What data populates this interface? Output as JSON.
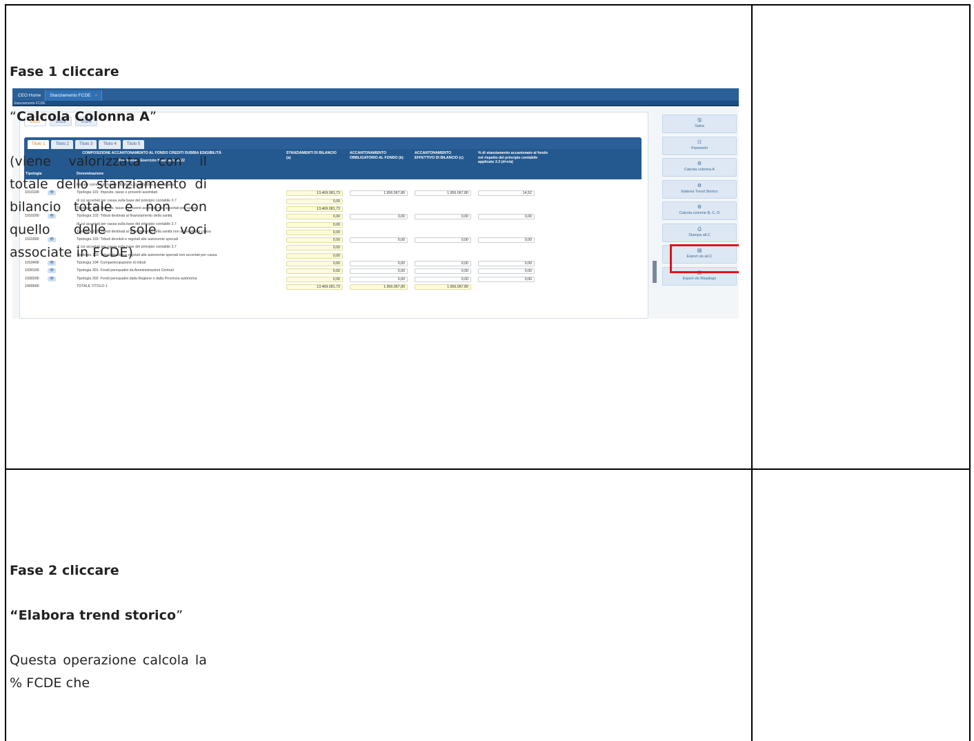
{
  "screenshot": {
    "app_tabs": [
      {
        "label": "CEO Home"
      },
      {
        "label": "Stanziamento FCDE"
      }
    ],
    "close_glyph": "×",
    "subtitle": "Stanziamento FCDE",
    "years": [
      "2022",
      "2023",
      "2024"
    ],
    "title_tabs": [
      "Titolo 1",
      "Titolo 2",
      "Titolo 3",
      "Titolo 4",
      "Titolo 5"
    ],
    "header": {
      "group_title": "COMPOSIZIONE ACCANTONAMENTO AL FONDO CREDITI DUBBIA ESIGIBILITÀ",
      "group_subtitle": "Previsione - Esercizio finanziario 2022",
      "col_tipologia": "Tipologia",
      "col_denominazione": "Denominazione",
      "col_a": "STANZIAMENTI DI BILANCIO (a)",
      "col_b": "ACCANTONAMENTO OBBLIGATORIO AL FONDO (b)",
      "col_c": "ACCANTONAMENTO EFFETTIVO DI BILANCIO (c)",
      "col_d": "% di stanziamento accantonato al fondo nel rispetto del principio contabile applicato 3.3 (d=c/a)"
    },
    "rows": [
      {
        "code": "",
        "eye": false,
        "den": "Entrate correnti di natura tributaria, contributiva e perequativa",
        "a": null,
        "b": null,
        "c": null,
        "d": null
      },
      {
        "code": "1010100",
        "eye": true,
        "den": "Tipologia 101: Imposte, tasse e proventi assimilati",
        "a": "13.469.081,73",
        "b": "1.956.067,80",
        "c": "1.956.067,80",
        "d": "14,52"
      },
      {
        "code": "",
        "eye": false,
        "den": "di cui accertati per cassa sulla base del principio contabile 3.7",
        "a": "0,00",
        "b": null,
        "c": null,
        "d": null
      },
      {
        "code": "",
        "eye": false,
        "den": "Tipologia 101: Imposte, tasse e proventi assimilati non accertati per cassa",
        "a": "13.469.081,73",
        "b": null,
        "c": null,
        "d": null
      },
      {
        "code": "1010200",
        "eye": true,
        "den": "Tipologia 102: Tributi destinati al finanziamento della sanità",
        "a": "0,00",
        "b": "0,00",
        "c": "0,00",
        "d": "0,00"
      },
      {
        "code": "",
        "eye": false,
        "den": "di cui accertati per cassa sulla base del principio contabile 3.7",
        "a": "0,00",
        "b": null,
        "c": null,
        "d": null
      },
      {
        "code": "",
        "eye": false,
        "den": "Tipologia 102: Tributi destinati al finanziamento della sanità non accertati per cassa",
        "a": "0,00",
        "b": null,
        "c": null,
        "d": null
      },
      {
        "code": "1010300",
        "eye": true,
        "den": "Tipologia 103: Tributi devoluti e regolati alle autonomie speciali",
        "a": "0,00",
        "b": "0,00",
        "c": "0,00",
        "d": "0,00"
      },
      {
        "code": "",
        "eye": false,
        "den": "di cui accertati per cassa sulla base del principio contabile 3.7",
        "a": "0,00",
        "b": null,
        "c": null,
        "d": null
      },
      {
        "code": "",
        "eye": false,
        "den": "Tipologia 103: Tributi devoluti e regolati alle autonomie speciali non accertati per cassa",
        "a": "0,00",
        "b": null,
        "c": null,
        "d": null
      },
      {
        "code": "1010400",
        "eye": true,
        "den": "Tipologia 104: Compartecipazione di tributi",
        "a": "0,00",
        "b": "0,00",
        "c": "0,00",
        "d": "0,00"
      },
      {
        "code": "1030100",
        "eye": true,
        "den": "Tipologia 301: Fondi perequativi da Amministrazioni Centrali",
        "a": "0,00",
        "b": "0,00",
        "c": "0,00",
        "d": "0,00"
      },
      {
        "code": "1030200",
        "eye": true,
        "den": "Tipologia 302: Fondi perequativi dalla Regione o dalla Provincia autonoma",
        "a": "0,00",
        "b": "0,00",
        "c": "0,00",
        "d": "0,00"
      },
      {
        "code": "1000000",
        "eye": false,
        "den": "TOTALE TITOLO 1",
        "a": "13.469.081,73",
        "b": "1.956.067,80",
        "c": "1.956.067,80",
        "d": null
      }
    ],
    "side_buttons": [
      {
        "icon": "save-icon",
        "glyph": "🖫",
        "label": "Salva"
      },
      {
        "icon": "parameters-icon",
        "glyph": "☷",
        "label": "Parametri"
      },
      {
        "icon": "calculate-icon",
        "glyph": "⚙",
        "label": "Calcola colonna A"
      },
      {
        "icon": "calculate-icon",
        "glyph": "⚙",
        "label": "Elabora Trend Storico"
      },
      {
        "icon": "calculate-icon",
        "glyph": "⚙",
        "label": "Calcola colonne B, C, D"
      },
      {
        "icon": "print-icon",
        "glyph": "⎙",
        "label": "Stampa all.C"
      },
      {
        "icon": "file-icon",
        "glyph": "▤",
        "label": "Export xls all.C"
      },
      {
        "icon": "file-icon",
        "glyph": "▤",
        "label": "Export xls Riepilogo"
      }
    ],
    "highlight_color": "#e01414",
    "eye_glyph": "👁"
  },
  "step1": {
    "title": "Fase 1 cliccare",
    "quote_open": "“",
    "action": "Calcola Colonna A",
    "quote_close": "”",
    "description": "(viene valorizzata con il totale dello stanziamento di bilancio totale e non con quello delle sole voci associate in FCDE)"
  },
  "step2": {
    "title": "Fase 2 cliccare",
    "quote_open": "“",
    "action": "Elabora trend storico",
    "quote_close": "”",
    "description": "Questa operazione calcola la % FCDE che"
  }
}
